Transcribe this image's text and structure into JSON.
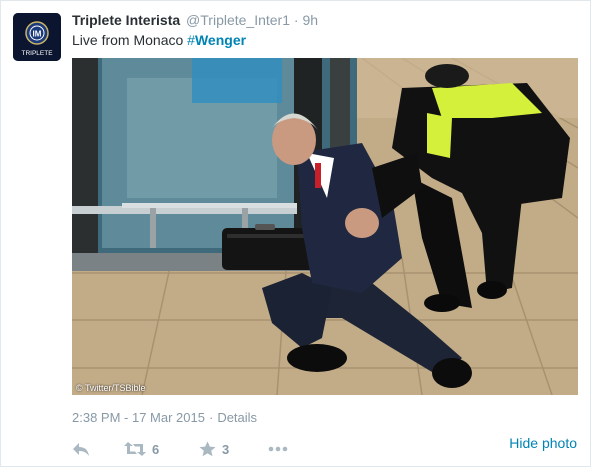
{
  "tweet": {
    "display_name": "Triplete Interista",
    "screen_name": "@Triplete_Inter1",
    "separator": "·",
    "time_ago": "9h",
    "text": "Live from Monaco ",
    "hashtag_symbol": "#",
    "hashtag": "Wenger",
    "photo_credit": "© Twitter/TSBible",
    "timestamp": "2:38 PM - 17 Mar 2015",
    "details_label": "Details",
    "retweet_count": "6",
    "favorite_count": "3",
    "hide_photo_label": "Hide photo"
  },
  "avatar": {
    "label": "TRIPLETE"
  },
  "icons": {
    "reply": "reply-icon",
    "retweet": "retweet-icon",
    "favorite": "star-icon",
    "more": "more-dots-icon"
  },
  "colors": {
    "link": "#0084b4",
    "muted": "#8899a6",
    "text": "#292f33"
  }
}
